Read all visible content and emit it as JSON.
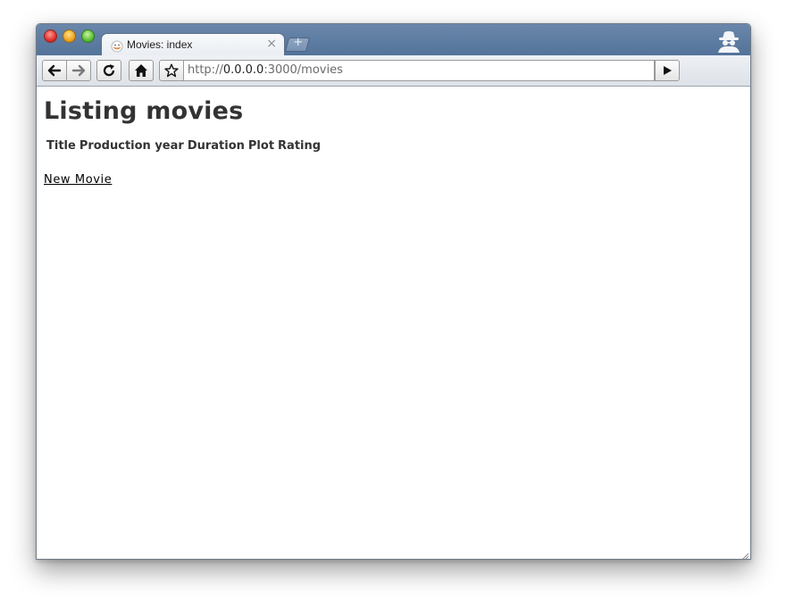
{
  "window": {
    "tab_title": "Movies: index",
    "tab_close": "×",
    "new_tab": "+",
    "traffic_lights": [
      "#e0302a",
      "#f0a321",
      "#5bbf36"
    ]
  },
  "toolbar": {
    "url_scheme": "http://",
    "url_host": "0.0.0.0",
    "url_rest": ":3000/movies",
    "icons": [
      "back-icon",
      "forward-icon",
      "reload-icon",
      "home-icon",
      "bookmark-star-icon",
      "go-icon"
    ]
  },
  "page": {
    "heading": "Listing movies",
    "table_headers": [
      "Title",
      "Production year",
      "Duration",
      "Plot",
      "Rating"
    ],
    "new_link": "New Movie"
  },
  "colors": {
    "titlebar": "#5b7aa0",
    "text": "#333333",
    "link": "#000000"
  }
}
